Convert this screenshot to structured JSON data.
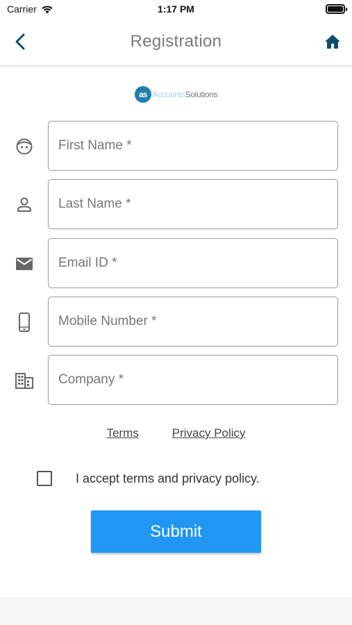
{
  "status_bar": {
    "carrier": "Carrier",
    "time": "1:17 PM"
  },
  "nav": {
    "title": "Registration",
    "back_icon": "chevron-left-icon",
    "home_icon": "home-icon",
    "accent_color": "#0d4d6b"
  },
  "logo": {
    "mark": "as",
    "text_part1": "Accounts",
    "text_part2": "Solutions",
    "brand_color": "#1f7fae"
  },
  "form": {
    "fields": [
      {
        "placeholder": "First Name *",
        "icon": "face-icon"
      },
      {
        "placeholder": "Last Name *",
        "icon": "person-icon"
      },
      {
        "placeholder": "Email ID *",
        "icon": "mail-icon"
      },
      {
        "placeholder": "Mobile Number *",
        "icon": "phone-icon"
      },
      {
        "placeholder": "Company *",
        "icon": "building-icon"
      }
    ]
  },
  "links": {
    "terms": "Terms",
    "privacy": "Privacy Policy"
  },
  "accept": {
    "label": "I accept terms and privacy policy.",
    "checked": false
  },
  "submit": {
    "label": "Submit",
    "color": "#2196f3"
  }
}
